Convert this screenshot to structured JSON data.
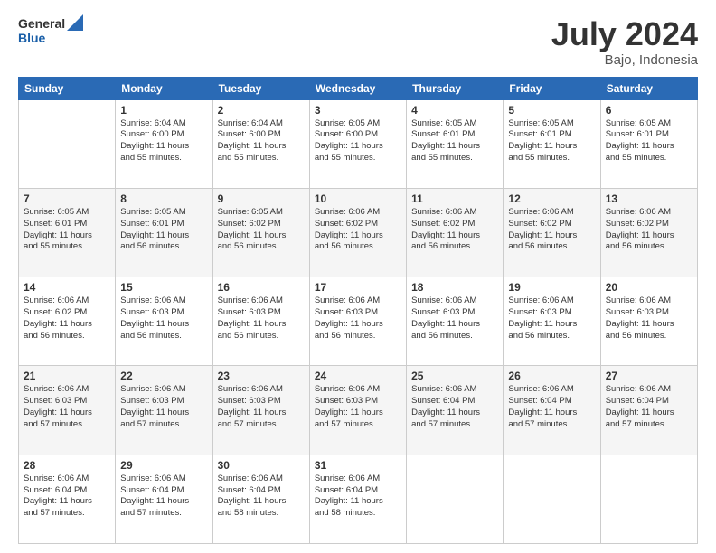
{
  "header": {
    "logo_general": "General",
    "logo_blue": "Blue",
    "title": "July 2024",
    "subtitle": "Bajo, Indonesia"
  },
  "days_of_week": [
    "Sunday",
    "Monday",
    "Tuesday",
    "Wednesday",
    "Thursday",
    "Friday",
    "Saturday"
  ],
  "weeks": [
    [
      {
        "day": "",
        "info": ""
      },
      {
        "day": "1",
        "info": "Sunrise: 6:04 AM\nSunset: 6:00 PM\nDaylight: 11 hours\nand 55 minutes."
      },
      {
        "day": "2",
        "info": "Sunrise: 6:04 AM\nSunset: 6:00 PM\nDaylight: 11 hours\nand 55 minutes."
      },
      {
        "day": "3",
        "info": "Sunrise: 6:05 AM\nSunset: 6:00 PM\nDaylight: 11 hours\nand 55 minutes."
      },
      {
        "day": "4",
        "info": "Sunrise: 6:05 AM\nSunset: 6:01 PM\nDaylight: 11 hours\nand 55 minutes."
      },
      {
        "day": "5",
        "info": "Sunrise: 6:05 AM\nSunset: 6:01 PM\nDaylight: 11 hours\nand 55 minutes."
      },
      {
        "day": "6",
        "info": "Sunrise: 6:05 AM\nSunset: 6:01 PM\nDaylight: 11 hours\nand 55 minutes."
      }
    ],
    [
      {
        "day": "7",
        "info": "Sunrise: 6:05 AM\nSunset: 6:01 PM\nDaylight: 11 hours\nand 55 minutes."
      },
      {
        "day": "8",
        "info": "Sunrise: 6:05 AM\nSunset: 6:01 PM\nDaylight: 11 hours\nand 56 minutes."
      },
      {
        "day": "9",
        "info": "Sunrise: 6:05 AM\nSunset: 6:02 PM\nDaylight: 11 hours\nand 56 minutes."
      },
      {
        "day": "10",
        "info": "Sunrise: 6:06 AM\nSunset: 6:02 PM\nDaylight: 11 hours\nand 56 minutes."
      },
      {
        "day": "11",
        "info": "Sunrise: 6:06 AM\nSunset: 6:02 PM\nDaylight: 11 hours\nand 56 minutes."
      },
      {
        "day": "12",
        "info": "Sunrise: 6:06 AM\nSunset: 6:02 PM\nDaylight: 11 hours\nand 56 minutes."
      },
      {
        "day": "13",
        "info": "Sunrise: 6:06 AM\nSunset: 6:02 PM\nDaylight: 11 hours\nand 56 minutes."
      }
    ],
    [
      {
        "day": "14",
        "info": "Sunrise: 6:06 AM\nSunset: 6:02 PM\nDaylight: 11 hours\nand 56 minutes."
      },
      {
        "day": "15",
        "info": "Sunrise: 6:06 AM\nSunset: 6:03 PM\nDaylight: 11 hours\nand 56 minutes."
      },
      {
        "day": "16",
        "info": "Sunrise: 6:06 AM\nSunset: 6:03 PM\nDaylight: 11 hours\nand 56 minutes."
      },
      {
        "day": "17",
        "info": "Sunrise: 6:06 AM\nSunset: 6:03 PM\nDaylight: 11 hours\nand 56 minutes."
      },
      {
        "day": "18",
        "info": "Sunrise: 6:06 AM\nSunset: 6:03 PM\nDaylight: 11 hours\nand 56 minutes."
      },
      {
        "day": "19",
        "info": "Sunrise: 6:06 AM\nSunset: 6:03 PM\nDaylight: 11 hours\nand 56 minutes."
      },
      {
        "day": "20",
        "info": "Sunrise: 6:06 AM\nSunset: 6:03 PM\nDaylight: 11 hours\nand 56 minutes."
      }
    ],
    [
      {
        "day": "21",
        "info": "Sunrise: 6:06 AM\nSunset: 6:03 PM\nDaylight: 11 hours\nand 57 minutes."
      },
      {
        "day": "22",
        "info": "Sunrise: 6:06 AM\nSunset: 6:03 PM\nDaylight: 11 hours\nand 57 minutes."
      },
      {
        "day": "23",
        "info": "Sunrise: 6:06 AM\nSunset: 6:03 PM\nDaylight: 11 hours\nand 57 minutes."
      },
      {
        "day": "24",
        "info": "Sunrise: 6:06 AM\nSunset: 6:03 PM\nDaylight: 11 hours\nand 57 minutes."
      },
      {
        "day": "25",
        "info": "Sunrise: 6:06 AM\nSunset: 6:04 PM\nDaylight: 11 hours\nand 57 minutes."
      },
      {
        "day": "26",
        "info": "Sunrise: 6:06 AM\nSunset: 6:04 PM\nDaylight: 11 hours\nand 57 minutes."
      },
      {
        "day": "27",
        "info": "Sunrise: 6:06 AM\nSunset: 6:04 PM\nDaylight: 11 hours\nand 57 minutes."
      }
    ],
    [
      {
        "day": "28",
        "info": "Sunrise: 6:06 AM\nSunset: 6:04 PM\nDaylight: 11 hours\nand 57 minutes."
      },
      {
        "day": "29",
        "info": "Sunrise: 6:06 AM\nSunset: 6:04 PM\nDaylight: 11 hours\nand 57 minutes."
      },
      {
        "day": "30",
        "info": "Sunrise: 6:06 AM\nSunset: 6:04 PM\nDaylight: 11 hours\nand 58 minutes."
      },
      {
        "day": "31",
        "info": "Sunrise: 6:06 AM\nSunset: 6:04 PM\nDaylight: 11 hours\nand 58 minutes."
      },
      {
        "day": "",
        "info": ""
      },
      {
        "day": "",
        "info": ""
      },
      {
        "day": "",
        "info": ""
      }
    ]
  ]
}
